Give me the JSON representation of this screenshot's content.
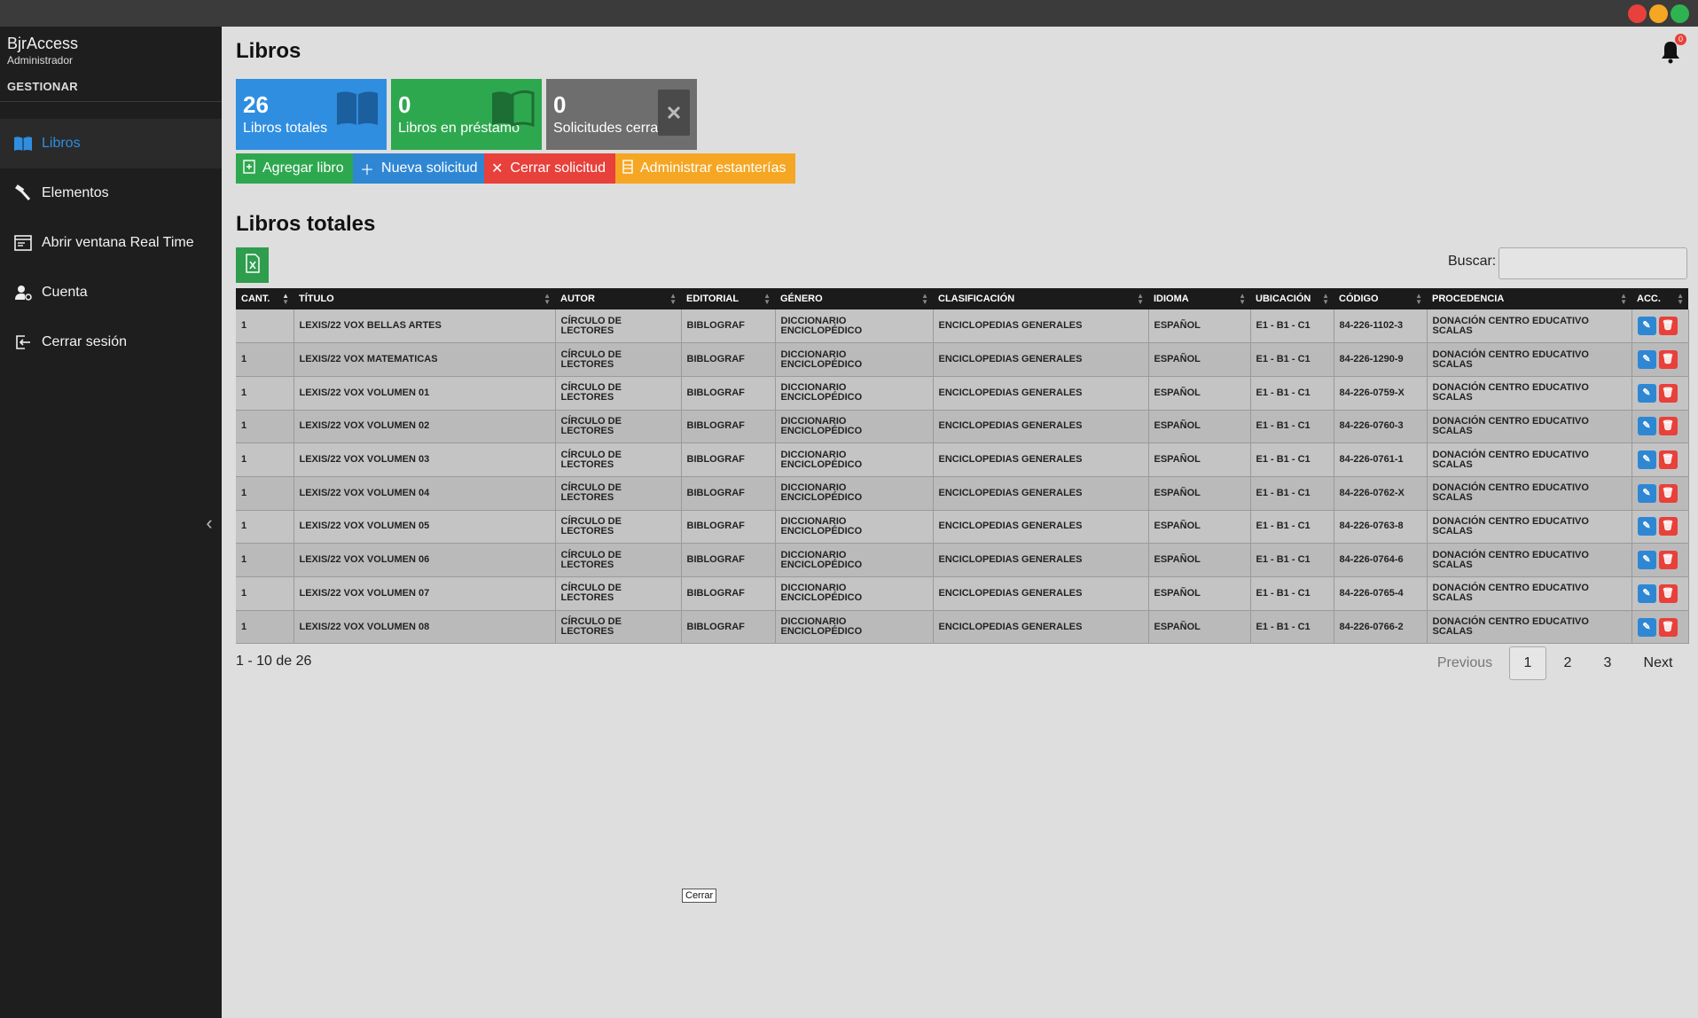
{
  "window": {
    "controls": [
      "close",
      "minimize",
      "maximize"
    ]
  },
  "sidebar": {
    "app_name": "BjrAccess",
    "role": "Administrador",
    "section": "GESTIONAR",
    "items": [
      {
        "label": "Libros",
        "icon": "book-icon",
        "active": true
      },
      {
        "label": "Elementos",
        "icon": "hammer-icon",
        "active": false
      },
      {
        "label": "Abrir ventana Real Time",
        "icon": "window-icon",
        "active": false
      },
      {
        "label": "Cuenta",
        "icon": "user-gear-icon",
        "active": false
      },
      {
        "label": "Cerrar sesión",
        "icon": "logout-icon",
        "active": false
      }
    ]
  },
  "header": {
    "title": "Libros",
    "notifications": "0"
  },
  "stats": [
    {
      "value": "26",
      "label": "Libros totales",
      "color": "#2f8ee0",
      "icon": "book-icon"
    },
    {
      "value": "0",
      "label": "Libros en préstamo",
      "color": "#2ea84f",
      "icon": "open-book-icon"
    },
    {
      "value": "0",
      "label": "Solicitudes cerradas",
      "color": "#6e6e6e",
      "icon": "close-box-icon"
    }
  ],
  "actions": [
    {
      "label": "Agregar libro",
      "color": "#2ea84f",
      "icon": "add-file-icon"
    },
    {
      "label": "Nueva solicitud",
      "color": "#2f87d4",
      "icon": "plus-icon"
    },
    {
      "label": "Cerrar solicitud",
      "color": "#e8403a",
      "icon": "x-icon"
    },
    {
      "label": "Administrar estanterías",
      "color": "#f5a623",
      "icon": "shelf-icon"
    }
  ],
  "table_section": {
    "title": "Libros totales",
    "search_label": "Buscar:",
    "search_value": ""
  },
  "table": {
    "columns": [
      "CANT.",
      "TÍTULO",
      "AUTOR",
      "EDITORIAL",
      "GÉNERO",
      "CLASIFICACIÓN",
      "IDIOMA",
      "UBICACIÓN",
      "CÓDIGO",
      "PROCEDENCIA",
      "ACC."
    ],
    "rows": [
      [
        "1",
        "LEXIS/22 VOX BELLAS ARTES",
        "CÍRCULO DE LECTORES",
        "BIBLOGRAF",
        "DICCIONARIO ENCICLOPÉDICO",
        "ENCICLOPEDIAS GENERALES",
        "ESPAÑOL",
        "E1 - B1 - C1",
        "84-226-1102-3",
        "DONACIÓN CENTRO EDUCATIVO SCALAS"
      ],
      [
        "1",
        "LEXIS/22 VOX MATEMATICAS",
        "CÍRCULO DE LECTORES",
        "BIBLOGRAF",
        "DICCIONARIO ENCICLOPÉDICO",
        "ENCICLOPEDIAS GENERALES",
        "ESPAÑOL",
        "E1 - B1 - C1",
        "84-226-1290-9",
        "DONACIÓN CENTRO EDUCATIVO SCALAS"
      ],
      [
        "1",
        "LEXIS/22 VOX VOLUMEN 01",
        "CÍRCULO DE LECTORES",
        "BIBLOGRAF",
        "DICCIONARIO ENCICLOPÉDICO",
        "ENCICLOPEDIAS GENERALES",
        "ESPAÑOL",
        "E1 - B1 - C1",
        "84-226-0759-X",
        "DONACIÓN CENTRO EDUCATIVO SCALAS"
      ],
      [
        "1",
        "LEXIS/22 VOX VOLUMEN 02",
        "CÍRCULO DE LECTORES",
        "BIBLOGRAF",
        "DICCIONARIO ENCICLOPÉDICO",
        "ENCICLOPEDIAS GENERALES",
        "ESPAÑOL",
        "E1 - B1 - C1",
        "84-226-0760-3",
        "DONACIÓN CENTRO EDUCATIVO SCALAS"
      ],
      [
        "1",
        "LEXIS/22 VOX VOLUMEN 03",
        "CÍRCULO DE LECTORES",
        "BIBLOGRAF",
        "DICCIONARIO ENCICLOPÉDICO",
        "ENCICLOPEDIAS GENERALES",
        "ESPAÑOL",
        "E1 - B1 - C1",
        "84-226-0761-1",
        "DONACIÓN CENTRO EDUCATIVO SCALAS"
      ],
      [
        "1",
        "LEXIS/22 VOX VOLUMEN 04",
        "CÍRCULO DE LECTORES",
        "BIBLOGRAF",
        "DICCIONARIO ENCICLOPÉDICO",
        "ENCICLOPEDIAS GENERALES",
        "ESPAÑOL",
        "E1 - B1 - C1",
        "84-226-0762-X",
        "DONACIÓN CENTRO EDUCATIVO SCALAS"
      ],
      [
        "1",
        "LEXIS/22 VOX VOLUMEN 05",
        "CÍRCULO DE LECTORES",
        "BIBLOGRAF",
        "DICCIONARIO ENCICLOPÉDICO",
        "ENCICLOPEDIAS GENERALES",
        "ESPAÑOL",
        "E1 - B1 - C1",
        "84-226-0763-8",
        "DONACIÓN CENTRO EDUCATIVO SCALAS"
      ],
      [
        "1",
        "LEXIS/22 VOX VOLUMEN 06",
        "CÍRCULO DE LECTORES",
        "BIBLOGRAF",
        "DICCIONARIO ENCICLOPÉDICO",
        "ENCICLOPEDIAS GENERALES",
        "ESPAÑOL",
        "E1 - B1 - C1",
        "84-226-0764-6",
        "DONACIÓN CENTRO EDUCATIVO SCALAS"
      ],
      [
        "1",
        "LEXIS/22 VOX VOLUMEN 07",
        "CÍRCULO DE LECTORES",
        "BIBLOGRAF",
        "DICCIONARIO ENCICLOPÉDICO",
        "ENCICLOPEDIAS GENERALES",
        "ESPAÑOL",
        "E1 - B1 - C1",
        "84-226-0765-4",
        "DONACIÓN CENTRO EDUCATIVO SCALAS"
      ],
      [
        "1",
        "LEXIS/22 VOX VOLUMEN 08",
        "CÍRCULO DE LECTORES",
        "BIBLOGRAF",
        "DICCIONARIO ENCICLOPÉDICO",
        "ENCICLOPEDIAS GENERALES",
        "ESPAÑOL",
        "E1 - B1 - C1",
        "84-226-0766-2",
        "DONACIÓN CENTRO EDUCATIVO SCALAS"
      ]
    ],
    "row_actions": {
      "edit_icon": "edit-icon",
      "delete_icon": "trash-icon"
    }
  },
  "pagination": {
    "info": "1 - 10 de 26",
    "previous": "Previous",
    "pages": [
      "1",
      "2",
      "3"
    ],
    "current": "1",
    "next": "Next"
  },
  "tooltip": {
    "text": "Cerrar"
  }
}
